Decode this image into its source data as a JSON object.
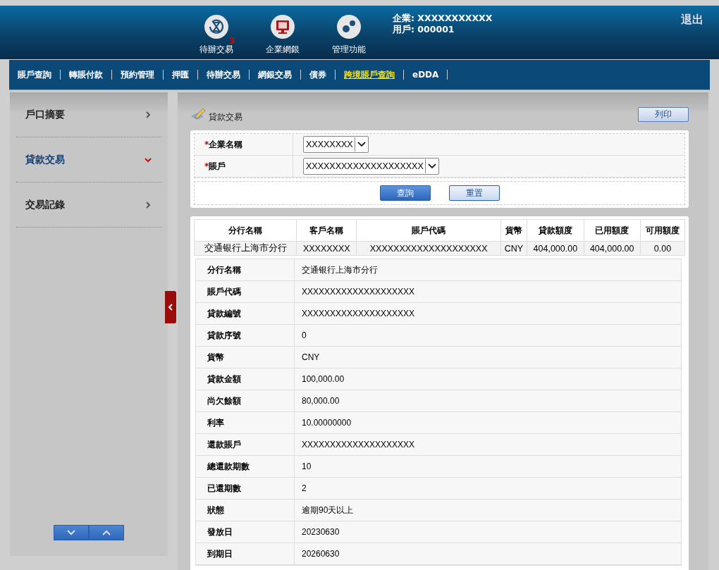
{
  "header": {
    "shortcuts": [
      {
        "kind": "pending",
        "label": "待辦交易",
        "badge": "3"
      },
      {
        "kind": "bank",
        "label": "企業網銀"
      },
      {
        "kind": "admin",
        "label": "管理功能"
      }
    ],
    "company": "企業: XXXXXXXXXXX",
    "user": "用戶: 000001",
    "logout": "退出"
  },
  "nav": [
    {
      "label": "賬戶查詢",
      "selected": false
    },
    {
      "label": "轉賬付款",
      "selected": false
    },
    {
      "label": "預約管理",
      "selected": false
    },
    {
      "label": "押匯",
      "selected": false
    },
    {
      "label": "待辦交易",
      "selected": false
    },
    {
      "label": "網銀交易",
      "selected": false
    },
    {
      "label": "債券",
      "selected": false
    },
    {
      "label": "跨境賬戶查詢",
      "selected": true
    },
    {
      "label": "eDDA",
      "selected": false
    }
  ],
  "sidebar": {
    "items": [
      {
        "label": "戶口摘要",
        "expanded": false
      },
      {
        "label": "貸款交易",
        "expanded": true
      },
      {
        "label": "交易記錄",
        "expanded": false
      }
    ]
  },
  "page_title": "貸款交易",
  "print_button": "列印",
  "form": {
    "fields": [
      {
        "label": "企業名稱",
        "required_mark": "*",
        "value": "XXXXXXXX"
      },
      {
        "label": "賬戶",
        "required_mark": "*",
        "value": "XXXXXXXXXXXXXXXXXXXX"
      }
    ],
    "query_button": "查詢",
    "reset_button": "重置"
  },
  "summary_table": {
    "columns": [
      "分行名稱",
      "客戶名稱",
      "賬戶代碼",
      "貨幣",
      "貸款額度",
      "已用額度",
      "可用額度"
    ],
    "rows": [
      [
        "交通银行上海市分行",
        "XXXXXXXX",
        "XXXXXXXXXXXXXXXXXXXX",
        "CNY",
        "404,000.00",
        "404,000.00",
        "0.00"
      ]
    ]
  },
  "detail": [
    {
      "label": "分行名稱",
      "value": "交通银行上海市分行"
    },
    {
      "label": "賬戶代碼",
      "value": "XXXXXXXXXXXXXXXXXXXX"
    },
    {
      "label": "貸款編號",
      "value": "XXXXXXXXXXXXXXXXXXXX"
    },
    {
      "label": "貸款序號",
      "value": "0"
    },
    {
      "label": "貨幣",
      "value": "CNY"
    },
    {
      "label": "貸款金額",
      "value": "100,000.00"
    },
    {
      "label": "尚欠餘額",
      "value": "80,000.00"
    },
    {
      "label": "利率",
      "value": "10.00000000"
    },
    {
      "label": "還款賬戶",
      "value": "XXXXXXXXXXXXXXXXXXXX"
    },
    {
      "label": "總還款期數",
      "value": "10"
    },
    {
      "label": "已還期數",
      "value": "2"
    },
    {
      "label": "狀態",
      "value": "逾期90天以上"
    },
    {
      "label": "發放日",
      "value": "20230630"
    },
    {
      "label": "到期日",
      "value": "20260630"
    }
  ]
}
